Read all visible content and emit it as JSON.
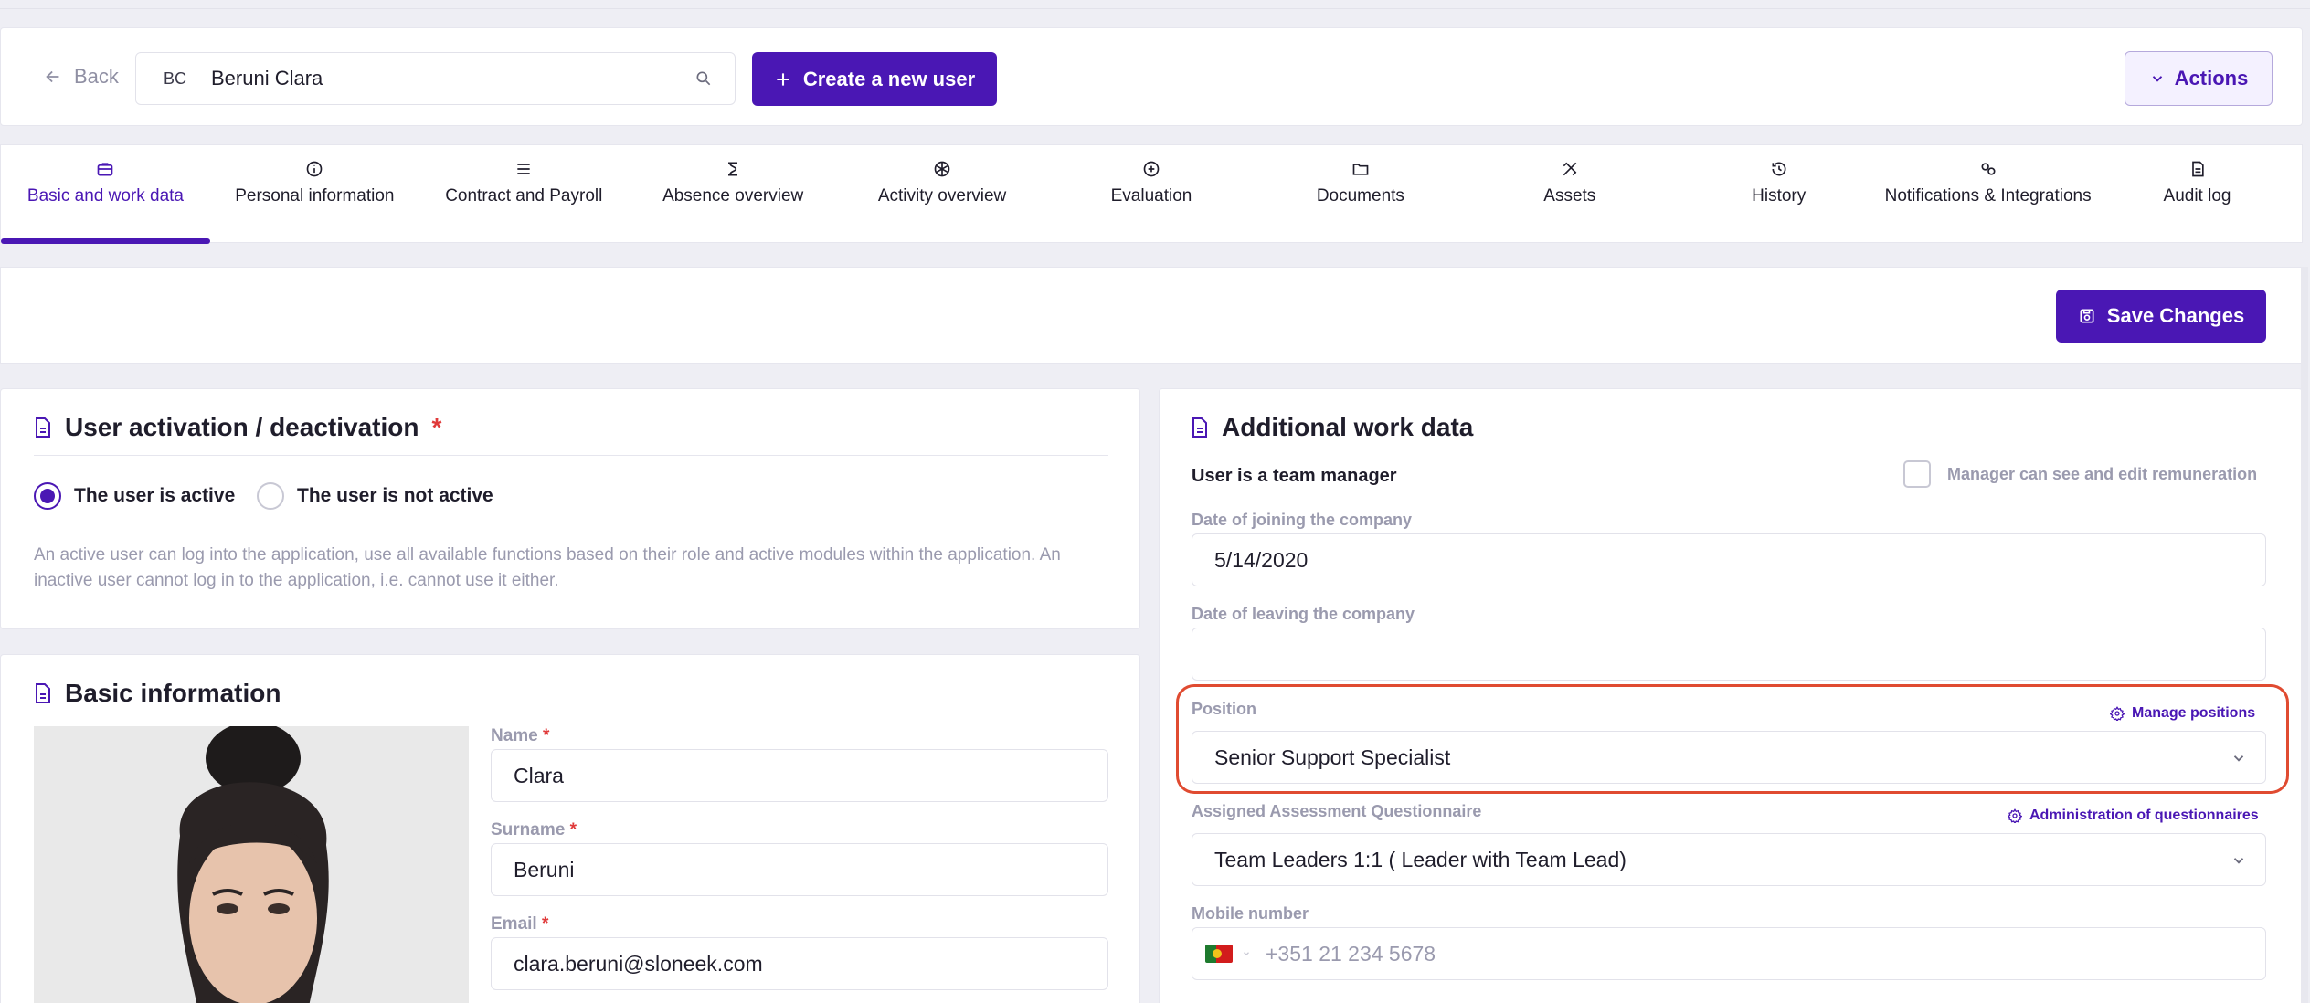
{
  "header": {
    "back_label": "Back",
    "search_initials": "BC",
    "search_name": "Beruni Clara",
    "create_label": "Create a new user",
    "actions_label": "Actions"
  },
  "tabs": [
    {
      "label": "Basic and work data",
      "icon": "briefcase-icon"
    },
    {
      "label": "Personal information",
      "icon": "info-icon"
    },
    {
      "label": "Contract and Payroll",
      "icon": "list-icon"
    },
    {
      "label": "Absence overview",
      "icon": "absence-icon"
    },
    {
      "label": "Activity overview",
      "icon": "activity-icon"
    },
    {
      "label": "Evaluation",
      "icon": "evaluation-icon"
    },
    {
      "label": "Documents",
      "icon": "folder-icon"
    },
    {
      "label": "Assets",
      "icon": "assets-icon"
    },
    {
      "label": "History",
      "icon": "history-icon"
    },
    {
      "label": "Notifications & Integrations",
      "icon": "notifications-icon"
    },
    {
      "label": "Audit log",
      "icon": "audit-icon"
    }
  ],
  "savebar": {
    "save_label": "Save Changes"
  },
  "activation": {
    "title": "User activation / deactivation",
    "required_mark": "*",
    "active_label": "The user is active",
    "inactive_label": "The user is not active",
    "help_text": "An active user can log into the application, use all available functions based on their role and active modules within the application. An inactive user cannot log in to the application, i.e. cannot use it either."
  },
  "basic_info": {
    "title": "Basic information",
    "name_label": "Name",
    "name_value": "Clara",
    "surname_label": "Surname",
    "surname_value": "Beruni",
    "email_label": "Email",
    "email_value": "clara.beruni@sloneek.com",
    "required_mark": "*"
  },
  "additional_work": {
    "title": "Additional work data",
    "team_manager_label": "User is a team manager",
    "manager_remuneration_label": "Manager can see and edit remuneration",
    "joining_label": "Date of joining the company",
    "joining_value": "5/14/2020",
    "leaving_label": "Date of leaving the company",
    "leaving_value": "",
    "position_label": "Position",
    "manage_positions_label": "Manage positions",
    "position_value": "Senior Support Specialist",
    "questionnaire_label": "Assigned Assessment Questionnaire",
    "questionnaire_admin_label": "Administration of questionnaires",
    "questionnaire_value": "Team Leaders 1:1 ( Leader with Team Lead)",
    "mobile_label": "Mobile number",
    "mobile_placeholder": "+351 21 234 5678"
  },
  "colors": {
    "accent": "#4a17b4",
    "highlight": "#e04b31"
  }
}
